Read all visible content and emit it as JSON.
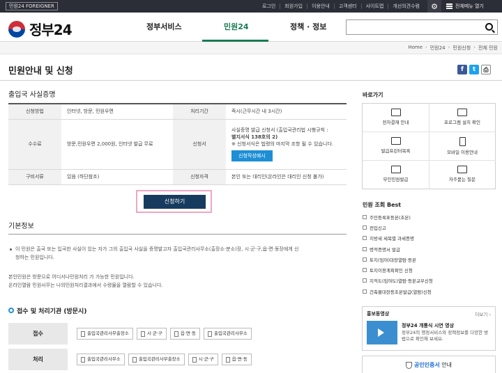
{
  "topbar": {
    "tag": "민원24 FOREIGNER",
    "links": [
      "로그인",
      "회원가입",
      "이용안내",
      "고객센터",
      "사이트맵",
      "개선의견수렴"
    ],
    "all_menu": "전체메뉴 열기"
  },
  "header": {
    "logo": "정부24",
    "nav": [
      "정부서비스",
      "민원24",
      "정책 · 정보"
    ],
    "active_nav": "민원24",
    "accent_color": "#1a7a53"
  },
  "breadcrumb": [
    "Home",
    "민원24",
    "민원신청",
    "전체 민원"
  ],
  "page": {
    "title": "민원안내 및 신청",
    "share": [
      "f",
      "t",
      "print"
    ]
  },
  "service": {
    "name": "출입국 사실증명",
    "rows": {
      "method_label": "신청방법",
      "method": "인터넷, 방문, 민원우편",
      "period_label": "처리기간",
      "period": "즉시(근무시간 내 3시간)",
      "fee_label": "수수료",
      "fee": "방문,민원우편 2,000원, 인터넷 발급 무료",
      "form_label": "신청서",
      "form_line1": "사실증명 발급 신청서 (출입국관리법 시행규칙 :",
      "form_line2": "별지서식 138호의 2)",
      "form_note": "※ 신청서식은 법령의 마지막 조항 될 수 있습니다.",
      "form_button": "신청작성예시",
      "docs_label": "구비서류",
      "docs": "있음 (하단참조)",
      "qualification_label": "신청자격",
      "qualification": "본인 또는 대리인(온라인은 대리인 신청 불가)"
    },
    "apply_button": "신청하기"
  },
  "basic": {
    "title": "기본정보",
    "para1_line1": "이 민원은 출국 또는 입국한 사실이 있는 자가 그의 출입국 사실을 증명발고자 출입국관리사무소(출장소·분소)장, 시·군·구,읍·면·동장에게 신",
    "para1_line2": "청하는 민원입니다.",
    "para2_line1": "본인민원은 방문으로 어디서나민원처리 가 가능한 민원입니다.",
    "para2_line2": "온라인열람 민원사무는 나의민원처리결과에서 수령물을 열람할 수 있습니다."
  },
  "process": {
    "title": "접수 및 처리기관 (방문시)",
    "receive_label": "접수",
    "receive_offices": [
      "출입국관리사무출장소",
      "시·군·구",
      "읍·면·동",
      "출입국관리사무소"
    ],
    "handle_label": "처리",
    "handle_offices": [
      "출입국관리사무소",
      "출입국관리사무출장소",
      "시·군·구",
      "읍·면·동"
    ]
  },
  "sidebar": {
    "quick_title": "바로가기",
    "quick_items": [
      {
        "label": "전자결재 안내",
        "icon": "download-icon"
      },
      {
        "label": "프로그램 설치 확인",
        "icon": "monitor-icon"
      },
      {
        "label": "발급프린터목록",
        "icon": "printer-icon"
      },
      {
        "label": "모바일 이용안내",
        "icon": "mobile-icon"
      },
      {
        "label": "무인민원발급",
        "icon": "kiosk-icon"
      },
      {
        "label": "자주묻는 질문",
        "icon": "faq-icon"
      }
    ],
    "best_title": "민원 조회 Best",
    "best_items": [
      "주민등록표등본(초본)",
      "전입신고",
      "지방세 세목별 과세증명",
      "병적증명서 발급",
      "토지(임야)대장열람·등본",
      "토지이용계획확인 신청",
      "지적도(임야도)열람·등본교부신청",
      "건축물대장등초본발급(열람)신청"
    ],
    "promo_title": "홍보동영상",
    "promo_more": "더보기 ›",
    "promo_video_title": "정부24 개통식 시연 영상",
    "promo_video_desc": "정부24의 행정서비스와 정책정보를 다양한 방법으로 확인해 보세요.",
    "cert_highlight": "공인인증서",
    "cert_rest": " 안내"
  }
}
